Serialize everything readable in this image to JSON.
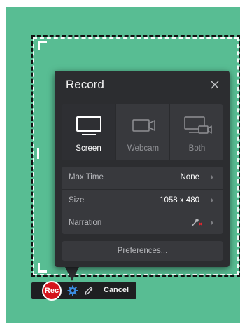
{
  "panel": {
    "title": "Record",
    "close_icon": "close-icon",
    "sources": [
      {
        "label": "Screen",
        "icon": "monitor-icon",
        "selected": true
      },
      {
        "label": "Webcam",
        "icon": "webcam-icon",
        "selected": false
      },
      {
        "label": "Both",
        "icon": "screen-and-webcam-icon",
        "selected": false
      }
    ],
    "settings": [
      {
        "label": "Max Time",
        "value": "None"
      },
      {
        "label": "Size",
        "value": "1058 x 480"
      },
      {
        "label": "Narration",
        "value": "",
        "icon": "microphone-muted-icon"
      }
    ],
    "preferences_label": "Preferences..."
  },
  "toolbar": {
    "rec_label": "Rec",
    "settings_icon": "gear-icon",
    "edit_icon": "pencil-icon",
    "cancel_label": "Cancel"
  },
  "colors": {
    "background": "#58bd93",
    "panel": "#2c2d30",
    "rec_button": "#d5141c",
    "gear_accent": "#3b8de0"
  }
}
